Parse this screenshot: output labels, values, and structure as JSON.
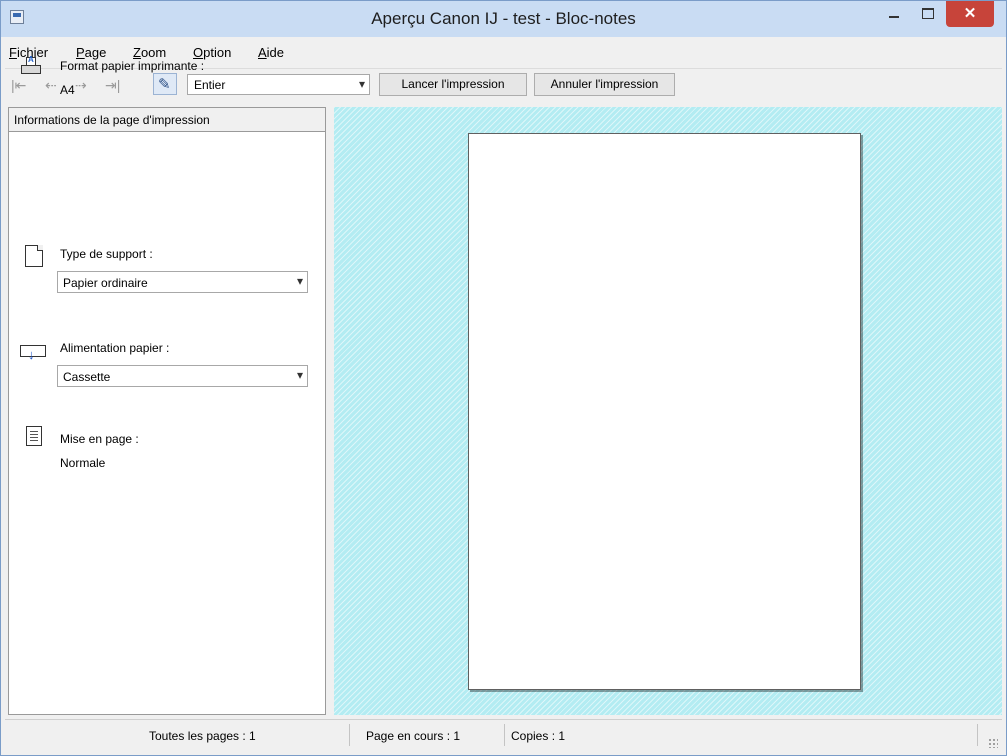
{
  "window": {
    "title": "Aperçu Canon IJ - test - Bloc-notes",
    "close_glyph": "✕"
  },
  "menu": {
    "items": [
      {
        "label": "Fichier"
      },
      {
        "label": "Page"
      },
      {
        "label": "Zoom"
      },
      {
        "label": "Option"
      },
      {
        "label": "Aide"
      }
    ]
  },
  "toolbar": {
    "zoom_value": "Entier",
    "print_label": "Lancer l'impression",
    "cancel_label": "Annuler l'impression",
    "nav_first": "|⇤",
    "nav_prev": "⇠",
    "nav_next": "⇢",
    "nav_last": "⇥|"
  },
  "panel": {
    "header": "Informations de la page d'impression",
    "printer_paper_label": "Format papier imprimante :",
    "printer_paper_value": "A4",
    "media_type_label": "Type de support :",
    "media_type_value": "Papier ordinaire",
    "paper_source_label": "Alimentation papier :",
    "paper_source_value": "Cassette",
    "layout_label": "Mise en page :",
    "layout_value": "Normale"
  },
  "status": {
    "total_pages": "Toutes les pages :   1",
    "current_page": "Page en cours :   1",
    "copies": "Copies :   1"
  },
  "colors": {
    "preview_background": "#b3ecf2",
    "title_bar": "#c9dcf3",
    "close_button": "#c7443a"
  },
  "icons": {
    "app": "notepad-app-icon",
    "tool": "page-options-icon",
    "printer_paper": "printer-paper-icon",
    "media_type": "media-sheet-icon",
    "paper_source": "paper-feed-icon",
    "layout": "layout-icon"
  }
}
